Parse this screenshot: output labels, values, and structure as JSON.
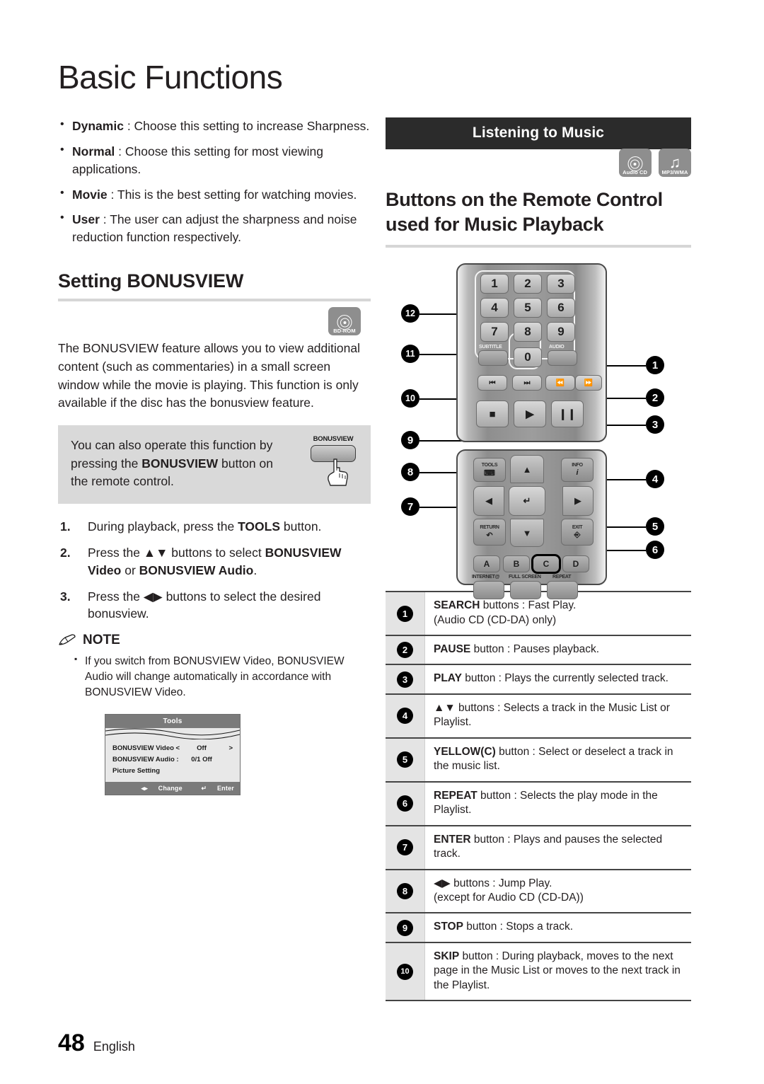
{
  "chapter": {
    "title": "Basic Functions"
  },
  "left": {
    "bullets": [
      {
        "term": "Dynamic",
        "text": " : Choose this setting to increase Sharpness."
      },
      {
        "term": "Normal",
        "text": " : Choose this setting for most viewing applications."
      },
      {
        "term": "Movie",
        "text": " : This is the best setting for watching movies."
      },
      {
        "term": "User",
        "text": " : The user can adjust the sharpness and noise reduction function respectively."
      }
    ],
    "section_heading": "Setting BONUSVIEW",
    "bd_badge": {
      "caption": "BD-ROM",
      "icon": "bd-disc-icon"
    },
    "paragraph": "The BONUSVIEW feature allows you to view additional content (such as commentaries) in a small screen window while the movie is playing. This function is only available if the disc has the bonusview feature.",
    "tip": {
      "text_1": "You can also operate this function by pressing the ",
      "bold": "BONUSVIEW",
      "text_2": " button on the remote control.",
      "button_label": "BONUSVIEW"
    },
    "steps": [
      {
        "num": "1.",
        "html": "During playback, press the <b>TOOLS</b> button."
      },
      {
        "num": "2.",
        "html": "Press the ▲▼ buttons to select <b>BONUSVIEW Video</b> or <b>BONUSVIEW Audio</b>."
      },
      {
        "num": "3.",
        "html": "Press the ◀▶ buttons to select the desired bonusview."
      }
    ],
    "note": {
      "heading": "NOTE",
      "items": [
        "If you switch from BONUSVIEW Video, BONUSVIEW Audio will change automatically in accordance with BONUSVIEW Video."
      ]
    },
    "osd": {
      "title": "Tools",
      "rows": [
        {
          "key": "BONUSVIEW Video <",
          "value": "Off",
          "arrow": ">"
        },
        {
          "key": "BONUSVIEW Audio :",
          "value": "0/1 Off",
          "arrow": ""
        },
        {
          "key": "Picture Setting",
          "value": "",
          "arrow": ""
        }
      ],
      "footer_change": "Change",
      "footer_enter": "Enter",
      "footer_change_icon": "◂▸",
      "footer_enter_icon": "↵"
    }
  },
  "right": {
    "band_title": "Listening to Music",
    "badges": [
      {
        "caption": "Audio CD",
        "icon": "audio-cd-disc-icon"
      },
      {
        "caption": "MP3/WMA",
        "icon": "music-note-icon"
      }
    ],
    "heading": "Buttons on the Remote Control used for Music Playback",
    "remote": {
      "keys": [
        "1",
        "2",
        "3",
        "4",
        "5",
        "6",
        "7",
        "8",
        "9",
        "0"
      ],
      "labels": {
        "subtitle": "SUBTITLE",
        "audio": "AUDIO",
        "tools": "TOOLS",
        "info": "INFO",
        "return": "RETURN",
        "exit": "EXIT",
        "a": "A",
        "b": "B",
        "c": "C",
        "d": "D",
        "internet": "INTERNET@",
        "fullscreen": "FULL SCREEN",
        "repeat": "REPEAT"
      },
      "callouts": [
        "1",
        "2",
        "3",
        "4",
        "5",
        "6",
        "7",
        "8",
        "9",
        "10",
        "11",
        "12"
      ]
    },
    "legend": [
      {
        "n": "1",
        "html": "<b>SEARCH</b> buttons : Fast Play.<br>(Audio CD (CD-DA) only)"
      },
      {
        "n": "2",
        "html": "<b>PAUSE</b> button : Pauses playback."
      },
      {
        "n": "3",
        "html": "<b>PLAY</b> button : Plays the currently selected track."
      },
      {
        "n": "4",
        "html": "▲▼ buttons : Selects a track in the Music List or Playlist."
      },
      {
        "n": "5",
        "html": "<b>YELLOW(C)</b> button : Select or deselect a track in the music list."
      },
      {
        "n": "6",
        "html": "<b>REPEAT</b> button : Selects the play mode in the Playlist."
      },
      {
        "n": "7",
        "html": "<b>ENTER</b> button : Plays and pauses the selected track."
      },
      {
        "n": "8",
        "html": "◀▶ buttons : Jump Play.<br>(except for Audio CD (CD-DA))"
      },
      {
        "n": "9",
        "html": "<b>STOP</b> button : Stops a track."
      },
      {
        "n": "10",
        "html": "<b>SKIP</b> button : During playback, moves to the next page in the Music List or moves to the next track in the Playlist."
      }
    ]
  },
  "footer": {
    "page_number": "48",
    "language": "English"
  },
  "colors": {
    "band_bg": "#2b2b2b",
    "badge_gray": "#8e8e8e",
    "tip_bg": "#d9d9d9",
    "rule_gray": "#d6d6d6",
    "legend_num_bg": "#e4e4e4"
  }
}
